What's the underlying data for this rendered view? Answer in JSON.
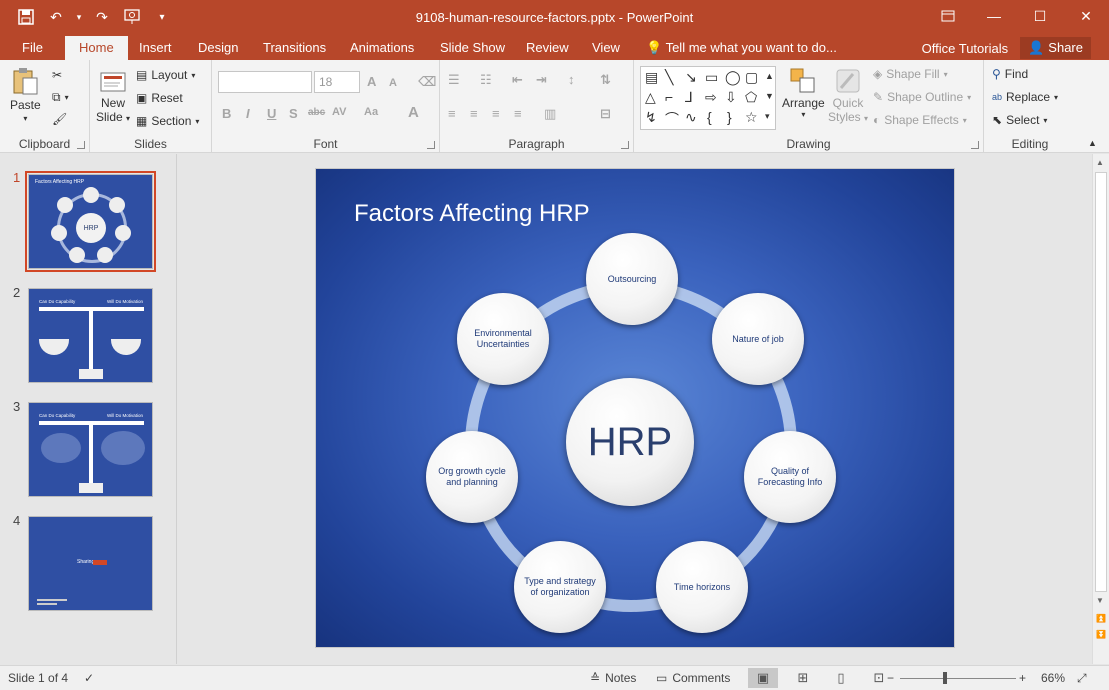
{
  "window": {
    "title": "9108-human-resource-factors.pptx - PowerPoint"
  },
  "qat": {
    "save_icon": "save-icon",
    "undo_icon": "undo-icon",
    "redo_icon": "redo-icon",
    "present_icon": "present-from-start-icon",
    "customize_icon": "customize-qat-icon"
  },
  "tabs": {
    "file": "File",
    "home": "Home",
    "insert": "Insert",
    "design": "Design",
    "transitions": "Transitions",
    "animations": "Animations",
    "slideshow": "Slide Show",
    "review": "Review",
    "view": "View",
    "tellme": "Tell me what you want to do...",
    "office_tutorials": "Office Tutorials",
    "share": "Share"
  },
  "ribbon": {
    "clipboard": {
      "label": "Clipboard",
      "paste": "Paste"
    },
    "slides": {
      "label": "Slides",
      "new_slide": "New",
      "new_slide2": "Slide",
      "layout": "Layout",
      "reset": "Reset",
      "section": "Section"
    },
    "font": {
      "label": "Font",
      "size": "18",
      "bold": "B",
      "italic": "I",
      "underline": "U",
      "shadow": "S",
      "strike": "abc",
      "spacing": "AV",
      "case": "Aa",
      "grow": "A",
      "shrink": "A",
      "color": "A"
    },
    "paragraph": {
      "label": "Paragraph"
    },
    "drawing": {
      "label": "Drawing",
      "arrange": "Arrange",
      "quick_styles1": "Quick",
      "quick_styles2": "Styles",
      "shape_fill": "Shape Fill",
      "shape_outline": "Shape Outline",
      "shape_effects": "Shape Effects"
    },
    "editing": {
      "label": "Editing",
      "find": "Find",
      "replace": "Replace",
      "select": "Select"
    }
  },
  "thumbnails": {
    "n1": "1",
    "n2": "2",
    "n3": "3",
    "n4": "4",
    "t1_title": "Factors Affecting HRP",
    "t1_hub": "HRP",
    "t2_left": "Can Do Capability",
    "t2_right": "Will Do Motivation",
    "t3_left": "Can Do Capability",
    "t3_right": "Will Do Motivation",
    "t4_center": "Sharing"
  },
  "slide": {
    "title": "Factors Affecting HRP",
    "hub": "HRP",
    "nodes": {
      "outsourcing": "Outsourcing",
      "nature": "Nature of job",
      "quality": "Quality of Forecasting Info",
      "time": "Time horizons",
      "type": "Type and strategy of organization",
      "org": "Org growth cycle and planning",
      "env": "Environmental Uncertainties"
    }
  },
  "status": {
    "slide_of": "Slide 1 of 4",
    "notes": "Notes",
    "comments": "Comments",
    "zoom": "66%"
  },
  "colors": {
    "accent": "#b7472a",
    "slide_bg": "#2f55b0",
    "node_text": "#1f3a78"
  }
}
